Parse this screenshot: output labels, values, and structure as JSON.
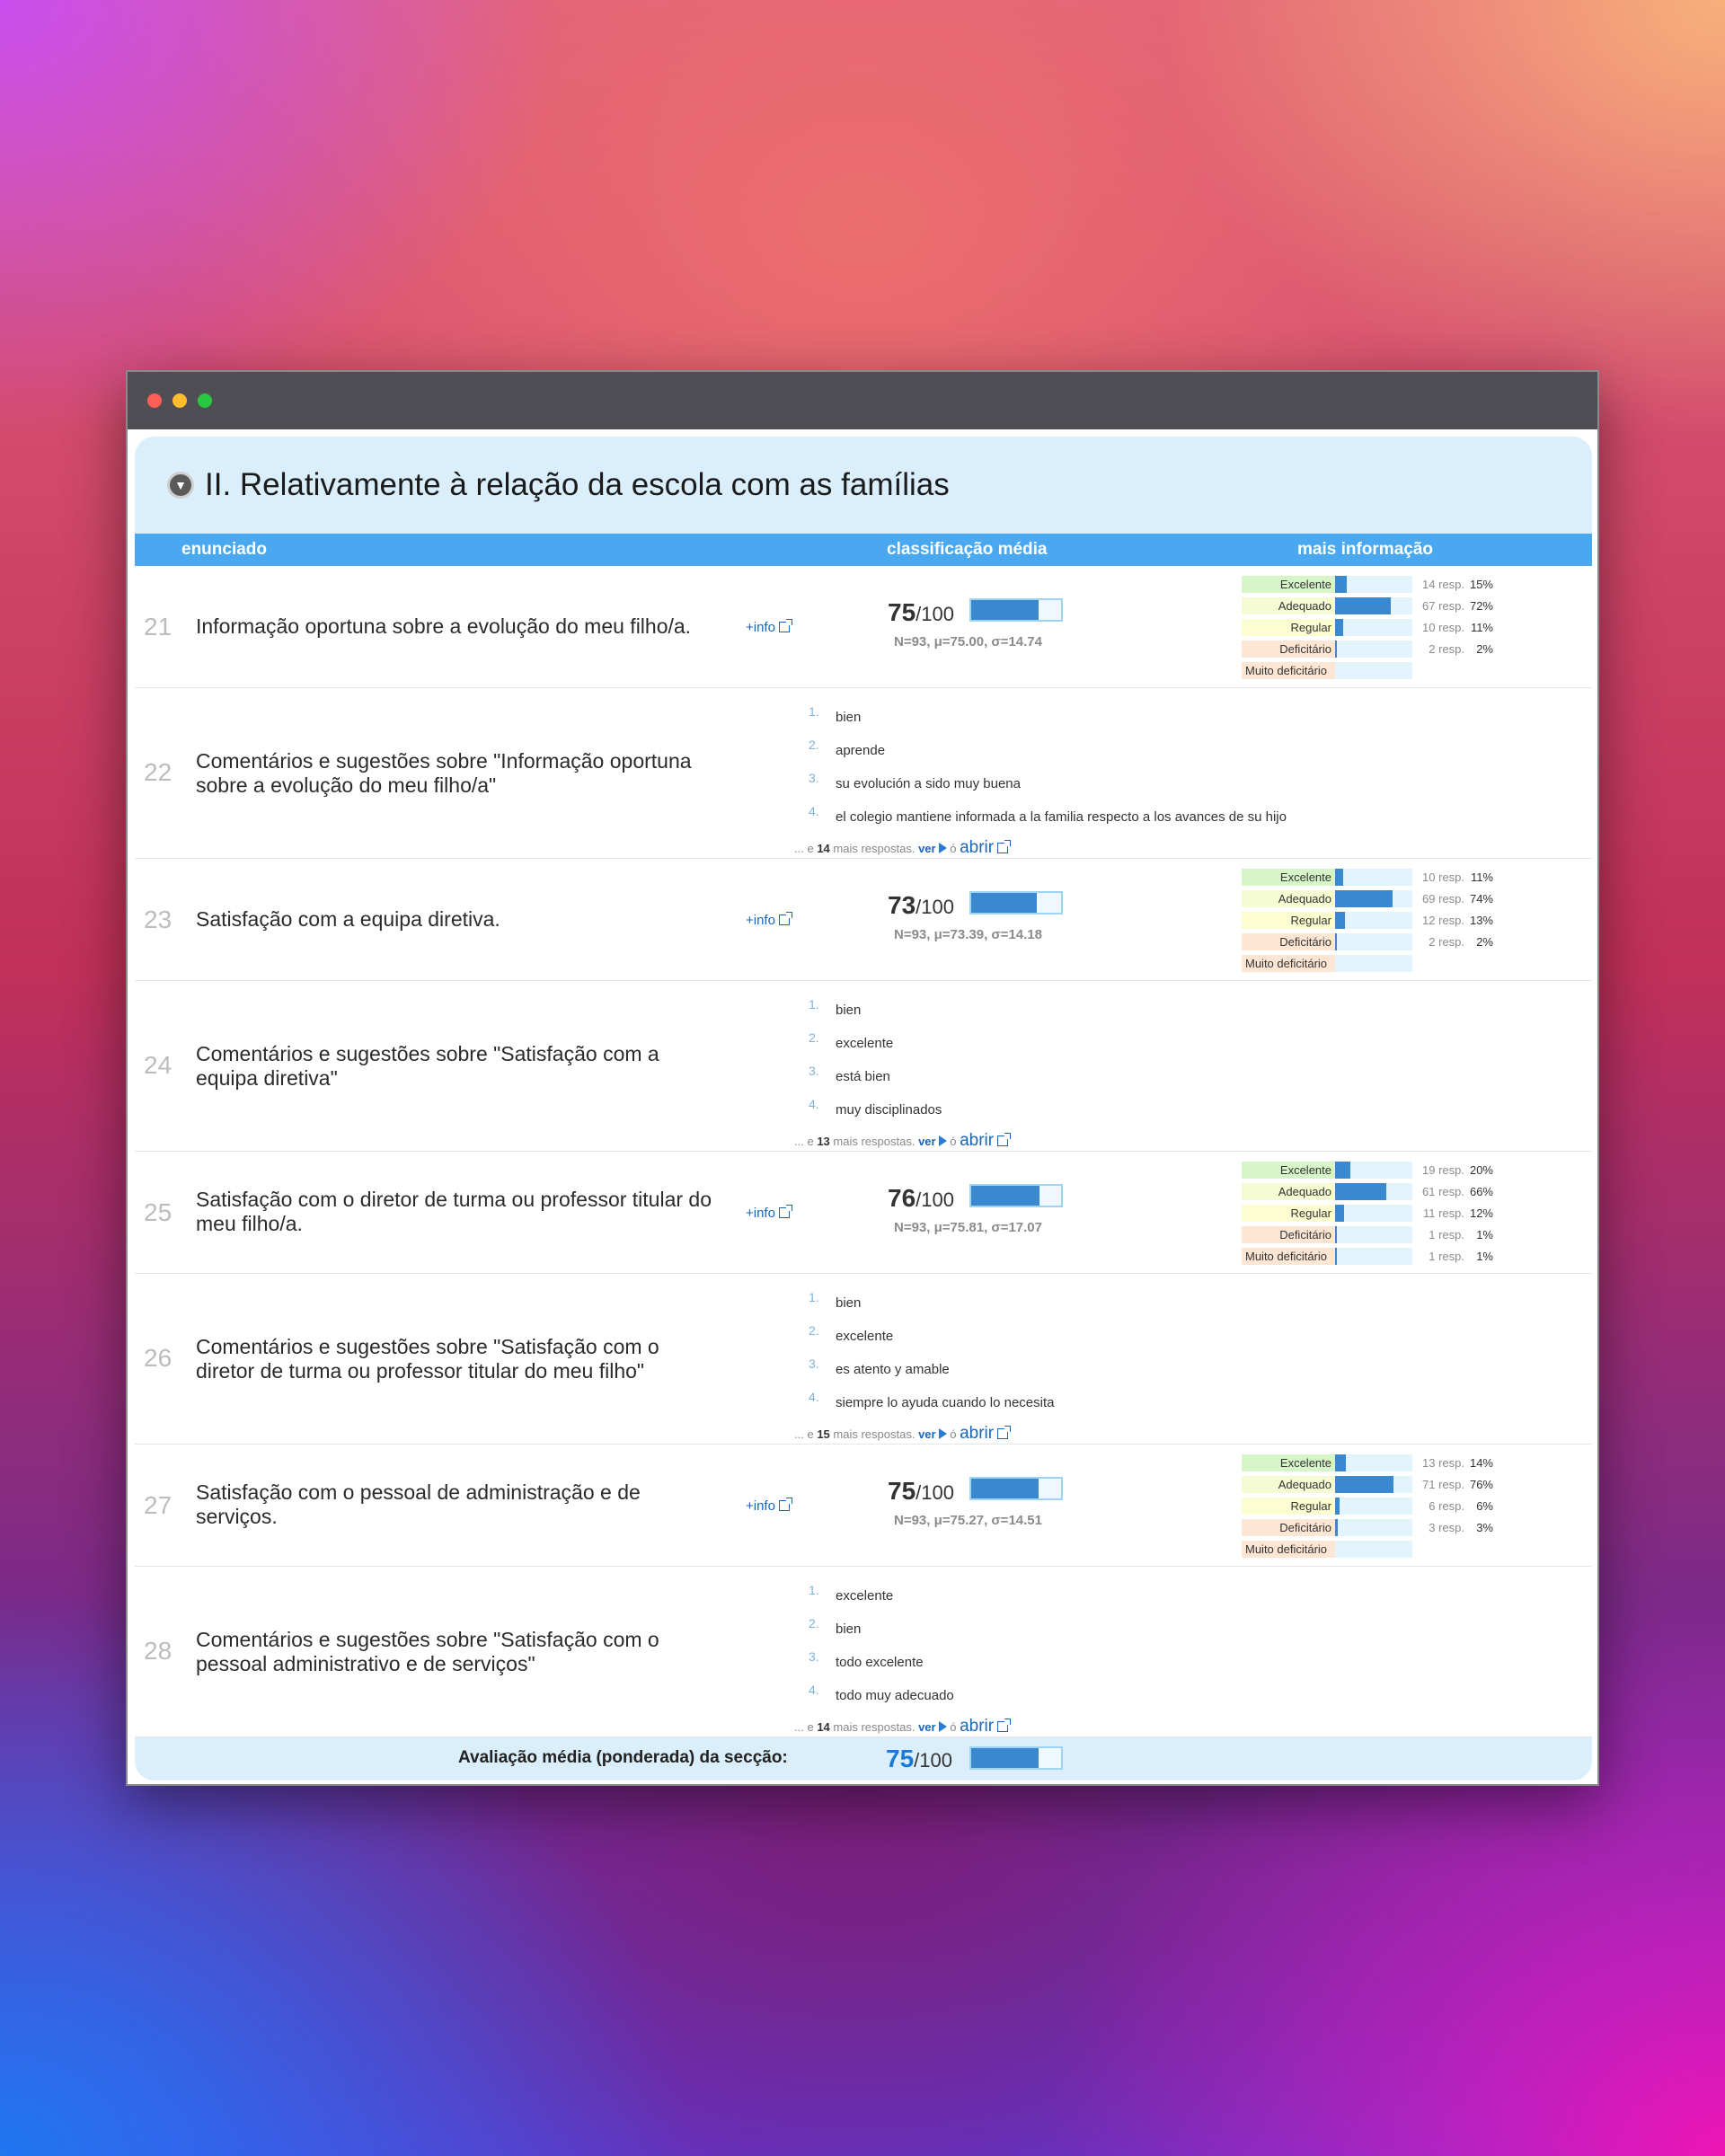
{
  "section": {
    "title": "II. Relativamente à relação da escola com as famílias",
    "collapse_icon": "chevron-down-icon"
  },
  "columns": {
    "enunciado": "enunciado",
    "classificacao": "classificação média",
    "mais_info": "mais informação"
  },
  "labels": {
    "info": "+info",
    "scale": "/100",
    "excelente": "Excelente",
    "adequado": "Adequado",
    "regular": "Regular",
    "deficitario": "Deficitário",
    "muito": "Muito deficitário",
    "ver": "ver",
    "o": "ó",
    "abrir": "abrir",
    "more_prefix": "... e",
    "more_suffix": "mais respostas."
  },
  "rows": [
    {
      "num": "21",
      "text": "Informação oportuna sobre a evolução do meu filho/a.",
      "score": "75",
      "score_fraction": 0.75,
      "stats": "N=93, μ=75.00, σ=14.74",
      "dist": [
        {
          "count": "14 resp.",
          "pct": "15%",
          "frac": 0.15
        },
        {
          "count": "67 resp.",
          "pct": "72%",
          "frac": 0.72
        },
        {
          "count": "10 resp.",
          "pct": "11%",
          "frac": 0.11
        },
        {
          "count": "2 resp.",
          "pct": "2%",
          "frac": 0.02
        },
        {
          "count": "",
          "pct": "",
          "frac": 0
        }
      ]
    },
    {
      "num": "22",
      "text": "Comentários e sugestões sobre \"Informação oportuna sobre a evolução do meu filho/a\"",
      "comments": [
        "bien",
        "aprende",
        "su evolución a sido muy buena",
        "el colegio mantiene informada a la familia respecto a los avances de su hijo"
      ],
      "more": "14"
    },
    {
      "num": "23",
      "text": "Satisfação com a equipa diretiva.",
      "score": "73",
      "score_fraction": 0.73,
      "stats": "N=93, μ=73.39, σ=14.18",
      "dist": [
        {
          "count": "10 resp.",
          "pct": "11%",
          "frac": 0.11
        },
        {
          "count": "69 resp.",
          "pct": "74%",
          "frac": 0.74
        },
        {
          "count": "12 resp.",
          "pct": "13%",
          "frac": 0.13
        },
        {
          "count": "2 resp.",
          "pct": "2%",
          "frac": 0.02
        },
        {
          "count": "",
          "pct": "",
          "frac": 0
        }
      ]
    },
    {
      "num": "24",
      "text": "Comentários e sugestões sobre \"Satisfação com a equipa diretiva\"",
      "comments": [
        "bien",
        "excelente",
        "está bien",
        "muy disciplinados"
      ],
      "more": "13"
    },
    {
      "num": "25",
      "text": "Satisfação com o diretor de turma ou professor titular do meu filho/a.",
      "score": "76",
      "score_fraction": 0.76,
      "stats": "N=93, μ=75.81, σ=17.07",
      "dist": [
        {
          "count": "19 resp.",
          "pct": "20%",
          "frac": 0.2
        },
        {
          "count": "61 resp.",
          "pct": "66%",
          "frac": 0.66
        },
        {
          "count": "11 resp.",
          "pct": "12%",
          "frac": 0.12
        },
        {
          "count": "1 resp.",
          "pct": "1%",
          "frac": 0.01
        },
        {
          "count": "1 resp.",
          "pct": "1%",
          "frac": 0.01
        }
      ]
    },
    {
      "num": "26",
      "text": "Comentários e sugestões sobre \"Satisfação com o diretor de turma ou professor titular do meu filho\"",
      "comments": [
        "bien",
        "excelente",
        "es atento y amable",
        "siempre lo ayuda cuando lo necesita"
      ],
      "more": "15"
    },
    {
      "num": "27",
      "text": "Satisfação com o pessoal de administração e de serviços.",
      "score": "75",
      "score_fraction": 0.75,
      "stats": "N=93, μ=75.27, σ=14.51",
      "dist": [
        {
          "count": "13 resp.",
          "pct": "14%",
          "frac": 0.14
        },
        {
          "count": "71 resp.",
          "pct": "76%",
          "frac": 0.76
        },
        {
          "count": "6 resp.",
          "pct": "6%",
          "frac": 0.06
        },
        {
          "count": "3 resp.",
          "pct": "3%",
          "frac": 0.03
        },
        {
          "count": "",
          "pct": "",
          "frac": 0
        }
      ]
    },
    {
      "num": "28",
      "text": "Comentários e sugestões sobre \"Satisfação com o pessoal administrativo e de serviços\"",
      "comments": [
        "excelente",
        "bien",
        "todo excelente",
        "todo muy adecuado"
      ],
      "more": "14"
    }
  ],
  "footer": {
    "label": "Avaliação média (ponderada) da secção:",
    "score": "75",
    "score_fraction": 0.75
  }
}
